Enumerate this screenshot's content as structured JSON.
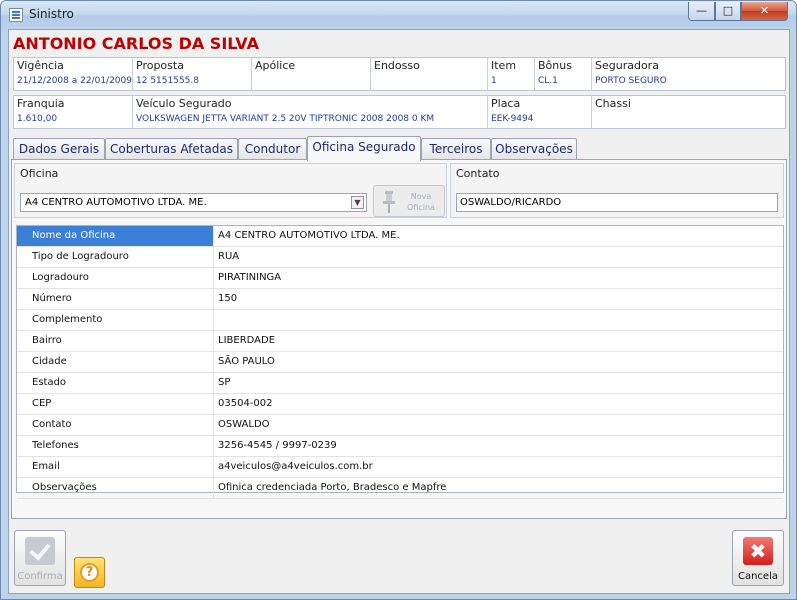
{
  "window": {
    "title": "Sinistro"
  },
  "insured": {
    "name": "ANTONIO CARLOS DA SILVA"
  },
  "header_row1": [
    {
      "label": "Vigência",
      "value": "21/12/2008 a 22/01/2009"
    },
    {
      "label": "Proposta",
      "value": "12 5151555.8"
    },
    {
      "label": "Apólice",
      "value": ""
    },
    {
      "label": "Endosso",
      "value": ""
    },
    {
      "label": "Item",
      "value": "1"
    },
    {
      "label": "Bônus",
      "value": "CL.1"
    },
    {
      "label": "Seguradora",
      "value": "PORTO SEGURO"
    }
  ],
  "header_row2": [
    {
      "label": "Franquia",
      "value": "1.610,00"
    },
    {
      "label": "Veículo Segurado",
      "value": "VOLKSWAGEN JETTA VARIANT 2.5 20V TIPTRONIC 2008 2008 0 KM"
    },
    {
      "label": "Placa",
      "value": "EEK-9494"
    },
    {
      "label": "Chassi",
      "value": ""
    }
  ],
  "tabs": [
    {
      "label": "Dados Gerais"
    },
    {
      "label": "Coberturas Afetadas"
    },
    {
      "label": "Condutor"
    },
    {
      "label": "Oficina Segurado"
    },
    {
      "label": "Terceiros"
    },
    {
      "label": "Observações"
    }
  ],
  "oficina": {
    "group_label": "Oficina",
    "selected": "A4 CENTRO AUTOMOTIVO LTDA. ME.",
    "nova_label": "Nova Oficina"
  },
  "contato": {
    "group_label": "Contato",
    "value": "OSWALDO/RICARDO"
  },
  "details": [
    {
      "key": "Nome da Oficina",
      "value": "A4 CENTRO AUTOMOTIVO LTDA. ME."
    },
    {
      "key": "Tipo de Logradouro",
      "value": "RUA"
    },
    {
      "key": "Logradouro",
      "value": "PIRATININGA"
    },
    {
      "key": "Número",
      "value": "150"
    },
    {
      "key": "Complemento",
      "value": ""
    },
    {
      "key": "Bairro",
      "value": "LIBERDADE"
    },
    {
      "key": "Cidade",
      "value": "SÃO PAULO"
    },
    {
      "key": "Estado",
      "value": "SP"
    },
    {
      "key": "CEP",
      "value": "03504-002"
    },
    {
      "key": "Contato",
      "value": "OSWALDO"
    },
    {
      "key": "Telefones",
      "value": "3256-4545 / 9997-0239"
    },
    {
      "key": "Email",
      "value": "a4veiculos@a4veiculos.com.br"
    },
    {
      "key": "Observações",
      "value": "Ofinica credenciada Porto, Bradesco e Mapfre"
    }
  ],
  "footer": {
    "confirma_label": "Confirma",
    "cancela_label": "Cancela"
  },
  "colors": {
    "insured_name": "#c00000",
    "header_value": "#1d3d9a",
    "selection": "#3c7fd8"
  }
}
